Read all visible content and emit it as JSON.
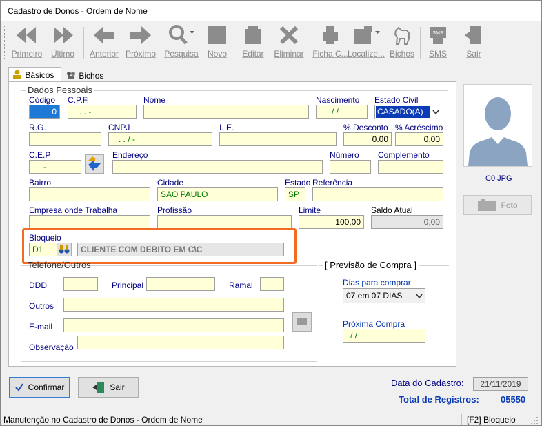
{
  "window": {
    "title": "Cadastro de Donos - Ordem de Nome"
  },
  "toolbar": {
    "primeiro": "Primeiro",
    "ultimo": "Último",
    "anterior": "Anterior",
    "proximo": "Próximo",
    "pesquisa": "Pesquisa",
    "novo": "Novo",
    "editar": "Editar",
    "eliminar": "Eliminar",
    "ficha": "Ficha C...",
    "localize": "Localize...",
    "bichos": "Bichos",
    "sms": "SMS",
    "sair": "Sair"
  },
  "tabs": {
    "basicos": "Básicos",
    "bichos": "Bichos"
  },
  "dados": {
    "title": "Dados Pessoais",
    "codigo_label": "Código",
    "codigo": "0",
    "cpf_label": "C.P.F.",
    "cpf": ". . -",
    "nome_label": "Nome",
    "nome": "",
    "nascimento_label": "Nascimento",
    "nascimento": "/ /",
    "estado_civil_label": "Estado Civil",
    "estado_civil": "CASADO(A)",
    "rg_label": "R.G.",
    "rg": "",
    "cnpj_label": "CNPJ",
    "cnpj": ". . / -",
    "ie_label": "I. E.",
    "ie": "",
    "desconto_label": "% Desconto",
    "desconto": "0.00",
    "acrescimo_label": "% Acréscimo",
    "acrescimo": "0.00",
    "cep_label": "C.E.P",
    "cep": "-",
    "endereco_label": "Endereço",
    "endereco": "",
    "numero_label": "Número",
    "numero": "",
    "complemento_label": "Complemento",
    "complemento": "",
    "bairro_label": "Bairro",
    "bairro": "",
    "cidade_label": "Cidade",
    "cidade": "SAO PAULO",
    "estado_label": "Estado",
    "estado": "SP",
    "referencia_label": "Referência",
    "referencia": "",
    "empresa_label": "Empresa onde Trabalha",
    "empresa": "",
    "profissao_label": "Profissão",
    "profissao": "",
    "limite_label": "Limite",
    "limite": "100,00",
    "saldo_label": "Saldo Atual",
    "saldo": "0,00",
    "bloqueio_label": "Bloqueio",
    "bloqueio_code": "D1",
    "bloqueio_desc": "CLIENTE COM DEBITO EM C\\C"
  },
  "telefone": {
    "title": "Telefone/Outros",
    "ddd_label": "DDD",
    "ddd": "",
    "principal_label": "Principal",
    "principal": "",
    "ramal_label": "Ramal",
    "ramal": "",
    "outros_label": "Outros",
    "outros": "",
    "email_label": "E-mail",
    "email": "",
    "obs_label": "Observação",
    "obs": ""
  },
  "previsao": {
    "title": "[ Previsão de Compra ]",
    "dias_label": "Dias para comprar",
    "dias": "07 em 07 DIAS",
    "proxima_label": "Próxima Compra",
    "proxima": "/ /"
  },
  "photo": {
    "filename": "C0.JPG",
    "button": "Foto"
  },
  "footer": {
    "confirmar": "Confirmar",
    "sair": "Sair",
    "data_label": "Data do Cadastro:",
    "data": "21/11/2019",
    "total_label": "Total de Registros:",
    "total": "05550"
  },
  "status": {
    "left": "Manutenção no Cadastro de Donos - Ordem de Nome",
    "right": "[F2] Bloqueio"
  },
  "colors": {
    "accent_orange": "#f26c23",
    "label_blue": "#000080",
    "field_yellow": "#ffffd8",
    "value_green": "#007a00"
  }
}
